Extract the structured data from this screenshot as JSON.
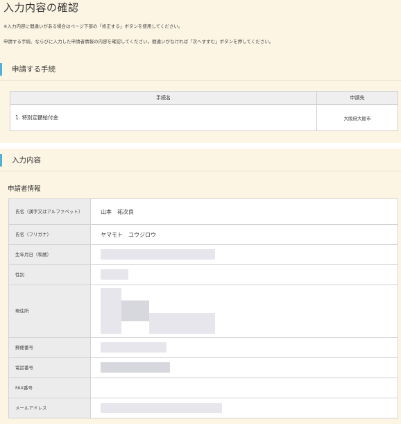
{
  "page": {
    "title": "入力内容の確認",
    "note1": "※入力内容に間違いがある場合はページ下部の「修正する」ボタンを使用してください。",
    "note2": "申請する手続、ならびに入力した申請者情報の内容を確認してください。間違いがなければ「次へすすむ」ボタンを押してください。"
  },
  "procedures": {
    "heading": "申請する手続",
    "columns": [
      "手続名",
      "申請先"
    ],
    "rows": [
      {
        "name": "1. 特別定額給付金",
        "dest": "大阪府大阪市"
      }
    ]
  },
  "input": {
    "heading": "入力内容",
    "subheading": "申請者情報",
    "fields": [
      {
        "label": "氏名（漢字又はアルファベット）",
        "value": "山本　祐次良"
      },
      {
        "label": "氏名（フリガナ）",
        "value": "ヤマモト　ユウジロウ"
      },
      {
        "label": "生年月日（和暦）",
        "value": ""
      },
      {
        "label": "性別",
        "value": ""
      },
      {
        "label": "現住所",
        "value": ""
      },
      {
        "label": "郵便番号",
        "value": ""
      },
      {
        "label": "電話番号",
        "value": ""
      },
      {
        "label": "FAX番号",
        "value": ""
      },
      {
        "label": "メールアドレス",
        "value": ""
      }
    ]
  }
}
